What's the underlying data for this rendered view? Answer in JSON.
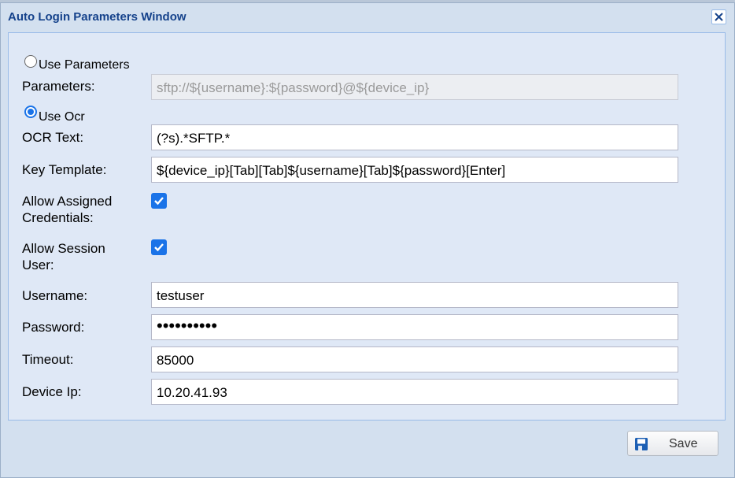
{
  "window": {
    "title": "Auto Login Parameters Window"
  },
  "icons": {
    "close": "close-x-icon",
    "save": "floppy-disk-icon"
  },
  "colors": {
    "title": "#15428b",
    "accent": "#1a73e8",
    "panel": "#dfe8f6"
  },
  "form": {
    "use_parameters": {
      "label": "Use Parameters",
      "selected": false
    },
    "parameters": {
      "label": "Parameters:",
      "value": "sftp://${username}:${password}@${device_ip}",
      "disabled": true
    },
    "use_ocr": {
      "label": "Use Ocr",
      "selected": true
    },
    "ocr_text": {
      "label": "OCR Text:",
      "value": "(?s).*SFTP.*"
    },
    "key_template": {
      "label": "Key Template:",
      "value": "${device_ip}[Tab][Tab]${username}[Tab]${password}[Enter]"
    },
    "allow_assigned_credentials": {
      "label_line1": "Allow Assigned",
      "label_line2": "Credentials:",
      "checked": true
    },
    "allow_session_user": {
      "label_line1": "Allow Session",
      "label_line2": "User:",
      "checked": true
    },
    "username": {
      "label": "Username:",
      "value": "testuser"
    },
    "password": {
      "label": "Password:",
      "value": "••••••••••"
    },
    "timeout": {
      "label": "Timeout:",
      "value": "85000"
    },
    "device_ip": {
      "label": "Device Ip:",
      "value": "10.20.41.93"
    }
  },
  "footer": {
    "save_label": "Save"
  }
}
